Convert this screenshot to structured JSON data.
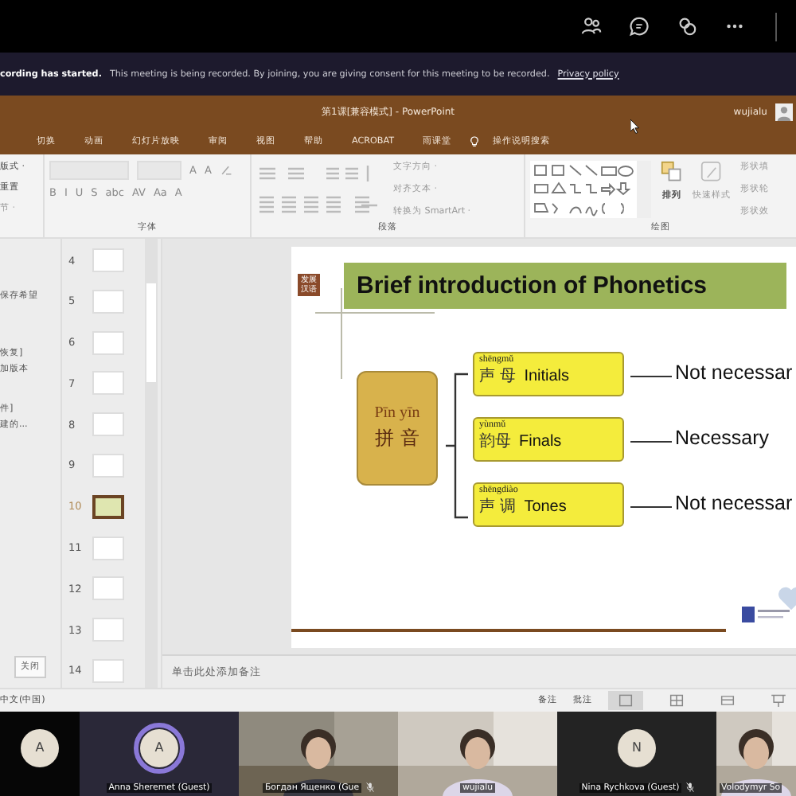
{
  "recording_banner": {
    "title": "cording has started.",
    "message": "This meeting is being recorded. By joining, you are giving consent for this meeting to be recorded.",
    "link": "Privacy policy"
  },
  "powerpoint": {
    "title": "第1课[兼容模式]  -  PowerPoint",
    "user": "wujialu",
    "tabs": [
      {
        "label": "切换",
        "selected": false
      },
      {
        "label": "动画",
        "selected": false
      },
      {
        "label": "幻灯片放映",
        "selected": false
      },
      {
        "label": "审阅",
        "selected": false
      },
      {
        "label": "视图",
        "selected": false
      },
      {
        "label": "帮助",
        "selected": false
      },
      {
        "label": "ACROBAT",
        "selected": false
      },
      {
        "label": "雨课堂",
        "selected": false
      }
    ],
    "tell_me": "操作说明搜索"
  },
  "ribbon": {
    "slide_commands": [
      "版式 ·",
      "重置",
      "节 ·"
    ],
    "font_buttons": [
      "A",
      "A",
      "B",
      "I",
      "U",
      "S",
      "abc",
      "AV",
      "Aa",
      "A"
    ],
    "text_commands": [
      "文字方向 ·",
      "对齐文本 ·",
      "转换为 SmartArt ·"
    ],
    "arrange": "排列",
    "quick_styles": "快速样式",
    "shape_commands": [
      "形状填",
      "形状轮",
      "形状效"
    ],
    "groups": [
      "字体",
      "段落",
      "绘图"
    ]
  },
  "task_pane": {
    "lines": [
      "保存希望",
      "恢复]",
      "加版本",
      "件]",
      "建的..."
    ],
    "close_button": "关闭"
  },
  "thumbnails": [
    {
      "number": "4",
      "selected": false
    },
    {
      "number": "5",
      "selected": false
    },
    {
      "number": "6",
      "selected": false
    },
    {
      "number": "7",
      "selected": false
    },
    {
      "number": "8",
      "selected": false
    },
    {
      "number": "9",
      "selected": false
    },
    {
      "number": "10",
      "selected": true
    },
    {
      "number": "11",
      "selected": false
    },
    {
      "number": "12",
      "selected": false
    },
    {
      "number": "13",
      "selected": false
    },
    {
      "number": "14",
      "selected": false
    }
  ],
  "slide": {
    "logo": "发展汉语",
    "title": "Brief introduction of Phonetics",
    "root": {
      "pinyin": "Pīn yīn",
      "hanzi": "拼 音"
    },
    "branches": [
      {
        "pinyin": "shēngmǔ",
        "hanzi": "声 母",
        "english": "Initials",
        "note": "Not necessar"
      },
      {
        "pinyin": "yùnmǔ",
        "hanzi": "韵母",
        "english": "Finals",
        "note": "Necessary"
      },
      {
        "pinyin": "shēngdiào",
        "hanzi": "声 调",
        "english": "Tones",
        "note": "Not necessar"
      }
    ]
  },
  "notes_placeholder": "单击此处添加备注",
  "status_bar": {
    "language": "中文(中国)",
    "notes": "备注",
    "comments": "批注"
  },
  "participants": [
    {
      "kind": "avatar",
      "initial": "A",
      "speaking": false,
      "muted": false
    },
    {
      "kind": "avatar",
      "initial": "A",
      "name": "Anna Sheremet (Guest)",
      "speaking": true,
      "muted": false
    },
    {
      "kind": "video",
      "name": "Богдан Ященко (Gue",
      "muted": true
    },
    {
      "kind": "video",
      "name": "wujialu",
      "muted": false
    },
    {
      "kind": "avatar",
      "initial": "N",
      "name": "Nina Rychkova (Guest)",
      "speaking": false,
      "muted": true
    },
    {
      "kind": "video",
      "name": "Volodymyr So",
      "muted": false
    }
  ]
}
